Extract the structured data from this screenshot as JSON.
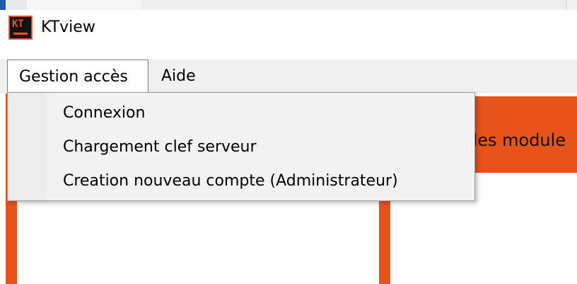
{
  "window": {
    "title": "KTview",
    "icon": "kt-logo-icon",
    "accent": "#e8531c"
  },
  "menu_bar": {
    "items": [
      {
        "label": "Gestion accès",
        "open": true
      },
      {
        "label": "Aide"
      }
    ]
  },
  "dropdown": {
    "items": [
      {
        "label": "Connexion"
      },
      {
        "label": "Chargement clef serveur"
      },
      {
        "label": "Creation nouveau compte (Administrateur)"
      }
    ]
  },
  "banner": {
    "text": "des module"
  }
}
